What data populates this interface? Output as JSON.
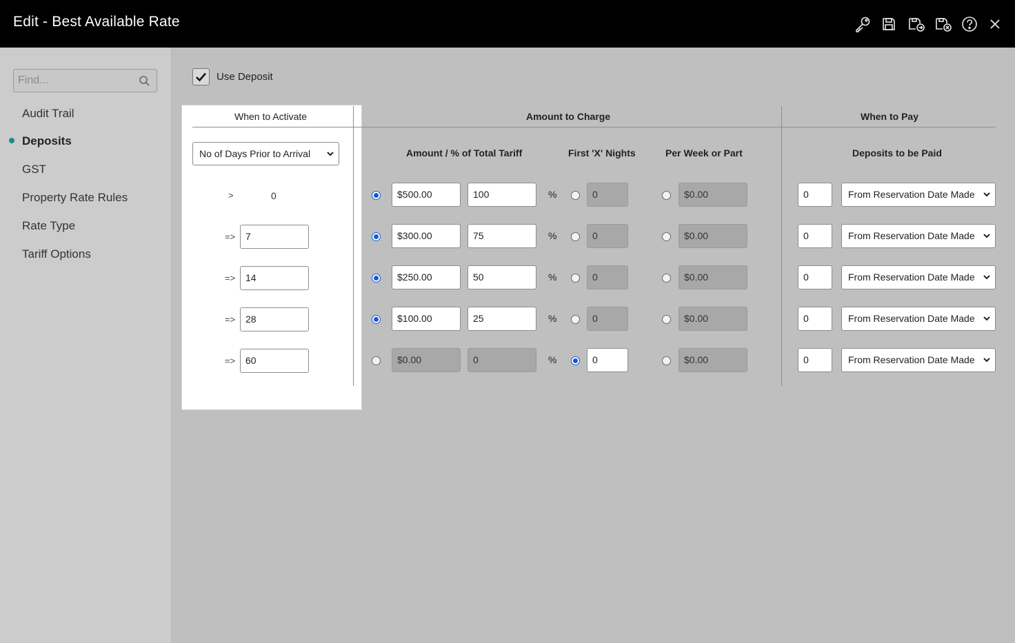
{
  "window": {
    "title": "Edit - Best Available Rate"
  },
  "toolbar": {
    "icons": [
      "key-icon",
      "save-icon",
      "save-and-new-icon",
      "save-and-close-icon",
      "help-icon",
      "close-icon"
    ]
  },
  "sidebar": {
    "search_placeholder": "Find...",
    "items": [
      {
        "label": "Audit Trail",
        "active": false
      },
      {
        "label": "Deposits",
        "active": true
      },
      {
        "label": "GST",
        "active": false
      },
      {
        "label": "Property Rate Rules",
        "active": false
      },
      {
        "label": "Rate Type",
        "active": false
      },
      {
        "label": "Tariff Options",
        "active": false
      }
    ]
  },
  "deposit": {
    "use_deposit_label": "Use Deposit",
    "use_deposit_checked": true,
    "headers": {
      "when_to_activate": "When to Activate",
      "amount_to_charge": "Amount to Charge",
      "when_to_pay": "When to Pay",
      "amount_pct": "Amount / % of Total Tariff",
      "first_x_nights": "First 'X' Nights",
      "per_week": "Per Week or Part",
      "deposits_to_be_paid": "Deposits to be Paid"
    },
    "activate_select": "No of Days Prior to Arrival",
    "percent_symbol": "%",
    "rows": [
      {
        "op": ">",
        "days": "0",
        "days_editable": false,
        "amount": "$500.00",
        "percent": "100",
        "nights": "0",
        "per_week": "$0.00",
        "pay_days": "0",
        "pay_from": "From Reservation Date Made",
        "mode": "amount"
      },
      {
        "op": "=>",
        "days": "7",
        "days_editable": true,
        "amount": "$300.00",
        "percent": "75",
        "nights": "0",
        "per_week": "$0.00",
        "pay_days": "0",
        "pay_from": "From Reservation Date Made",
        "mode": "amount"
      },
      {
        "op": "=>",
        "days": "14",
        "days_editable": true,
        "amount": "$250.00",
        "percent": "50",
        "nights": "0",
        "per_week": "$0.00",
        "pay_days": "0",
        "pay_from": "From Reservation Date Made",
        "mode": "amount"
      },
      {
        "op": "=>",
        "days": "28",
        "days_editable": true,
        "amount": "$100.00",
        "percent": "25",
        "nights": "0",
        "per_week": "$0.00",
        "pay_days": "0",
        "pay_from": "From Reservation Date Made",
        "mode": "amount"
      },
      {
        "op": "=>",
        "days": "60",
        "days_editable": true,
        "amount": "$0.00",
        "percent": "0",
        "nights": "0",
        "per_week": "$0.00",
        "pay_days": "0",
        "pay_from": "From Reservation Date Made",
        "mode": "nights"
      }
    ]
  },
  "colors": {
    "titlebar": "#000000",
    "accent_dot": "#1a8a8e",
    "radio_selected": "#1459d6"
  }
}
